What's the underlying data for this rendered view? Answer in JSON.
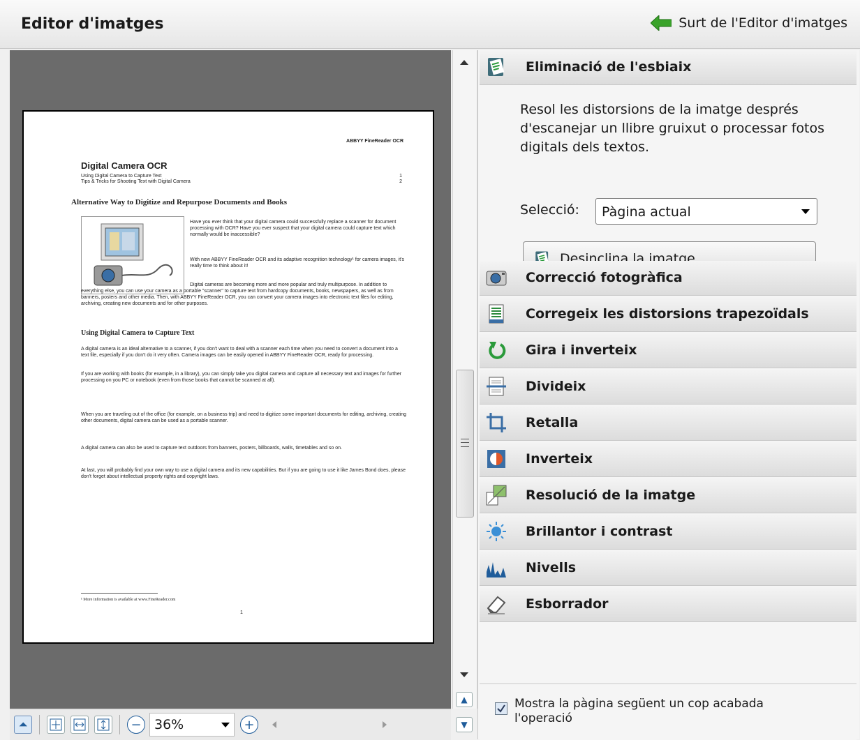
{
  "header": {
    "title": "Editor d'imatges",
    "exit_label": "Surt de l'Editor d'imatges"
  },
  "document": {
    "header_right": "ABBYY FineReader OCR",
    "title": "Digital Camera OCR",
    "toc": [
      {
        "text": "Using Digital Camera to Capture Text",
        "page": "1"
      },
      {
        "text": "Tips & Tricks for Shooting Text with Digital Camera",
        "page": "2"
      }
    ],
    "h2": "Alternative Way to Digitize and Repurpose Documents and Books",
    "para1": "Have you ever think that your digital camera could successfully replace a scanner for document processing with OCR? Have you ever suspect that your digital camera could capture text which normally would be inaccessible?",
    "para2": "With new ABBYY FineReader OCR and its adaptive recognition technology¹ for camera images, it's really time to think about it!",
    "para3": "Digital cameras are becoming more and more popular and truly multipurpose. In addition to everything else, you can use your camera as a portable \"scanner\" to capture text from hardcopy documents, books, newspapers, as well as from banners, posters and other media. Then, with ABBYY FineReader OCR, you can convert your camera images into electronic text files for editing, archiving, creating new documents and for other purposes.",
    "h3": "Using Digital Camera to Capture Text",
    "para4": "A digital camera is an ideal alternative to a scanner, if you don't want to deal with a scanner each time when you need to convert a document into a text file, especially if you don't do it very often. Camera images can be easily opened in ABBYY FineReader OCR, ready for processing.",
    "para5": "If you are working with books (for example, in a library), you can simply take you digital camera and capture all necessary text and images for further processing on you PC or notebook (even from those books that cannot be scanned at all).",
    "para6": "When you are traveling out of the office (for example, on a business trip) and need to digitize some important documents for editing, archiving, creating other documents, digital camera can be used as a portable scanner.",
    "para7": "A digital camera can also be used to capture text outdoors from banners, posters, billboards, walls, timetables and so on.",
    "para8": "At last, you will probably find your own way to use a digital camera and its new capabilities. But if you are going to use it like James Bond does, please don't forget about intellectual property rights and copyright laws.",
    "footnote": "¹ More information is available at www.FineReader.com",
    "page_num": "1"
  },
  "zoom": {
    "value": "36%"
  },
  "panel": {
    "expanded": {
      "title": "Eliminació de l'esbiaix",
      "description": "Resol les distorsions de la imatge després d'escanejar un llibre gruixut o processar fotos digitals dels textos.",
      "selection_label": "Selecció:",
      "selection_value": "Pàgina actual",
      "button_label": "Desinclina la imatge"
    },
    "sections": [
      {
        "label": "Correcció fotogràfica"
      },
      {
        "label": "Corregeix les distorsions trapezoïdals"
      },
      {
        "label": "Gira i inverteix"
      },
      {
        "label": "Divideix"
      },
      {
        "label": "Retalla"
      },
      {
        "label": "Inverteix"
      },
      {
        "label": "Resolució de la imatge"
      },
      {
        "label": "Brillantor i contrast"
      },
      {
        "label": "Nivells"
      },
      {
        "label": "Esborrador"
      }
    ],
    "footer": {
      "checkbox_label": "Mostra la pàgina següent un cop acabada l'operació",
      "checked": true
    }
  }
}
